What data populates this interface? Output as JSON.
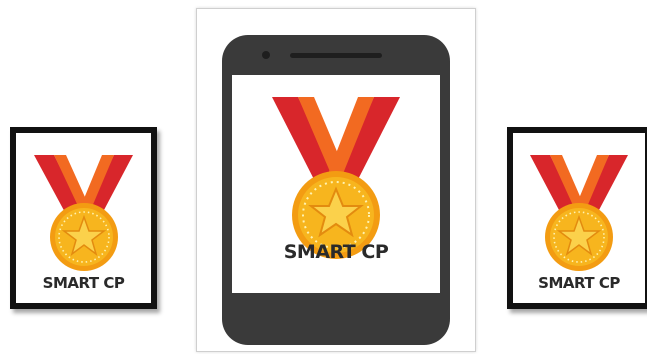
{
  "badges": {
    "left": {
      "label": "SMART CP"
    },
    "center": {
      "label": "SMART CP"
    },
    "right": {
      "label": "SMART CP"
    }
  },
  "colors": {
    "ribbon_red": "#d8262b",
    "ribbon_orange": "#f26a21",
    "medal_gold": "#f7b51e",
    "medal_rim": "#f39c12",
    "star": "#fbd14b",
    "frame": "#111111",
    "phone_body": "#3a3a3a"
  },
  "icons": [
    "medal-icon",
    "star-icon"
  ]
}
